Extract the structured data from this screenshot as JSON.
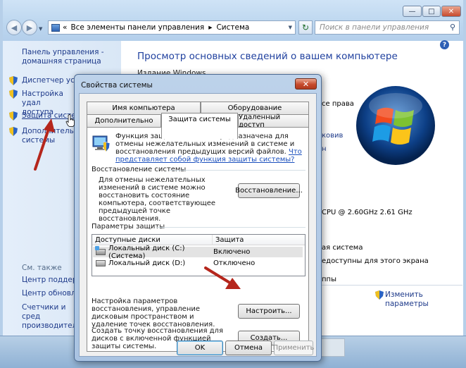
{
  "window": {
    "minimize_glyph": "—",
    "maximize_glyph": "□",
    "close_glyph": "✕",
    "address_path": [
      "Все элементы панели управления",
      "Система"
    ],
    "address_prefix": "«",
    "search_placeholder": "Поиск в панели управления"
  },
  "sidebar": {
    "home_link": "Панель управления - домашняя страница",
    "items": [
      {
        "label": "Диспетчер устр"
      },
      {
        "label": "Настройка удал доступа"
      },
      {
        "label": "Защита систем"
      },
      {
        "label": "Дополнительн системы"
      }
    ],
    "see_also": "См. также",
    "see_also_items": [
      "Центр поддерж",
      "Центр обновле",
      "Счетчики и сред производительн"
    ]
  },
  "main": {
    "heading": "Просмотр основных сведений о вашем компьютере",
    "partial_top": "Издание Windows",
    "partial_rights": "се права",
    "partial_link": "ковив",
    "partial_link2": "н",
    "partial_cpu": "CPU @ 2.60GHz   2.61 GHz",
    "partial_system": "ая система",
    "partial_pen": "едоступны для этого экрана",
    "partial_groups": "ппы",
    "change_params": "Изменить параметры"
  },
  "dialog": {
    "title": "Свойства системы",
    "close_glyph": "✕",
    "tabs_top": [
      "Имя компьютера",
      "Оборудование"
    ],
    "tabs_bottom": [
      "Дополнительно",
      "Защита системы",
      "Удаленный доступ"
    ],
    "active_tab": "Защита системы",
    "intro_text": "Функция защиты системы предназначена для отмены нежелательных изменений в системе и восстановления предыдущих версий файлов.",
    "intro_link": "Что представляет собой функция защиты системы?",
    "restore_group": "Восстановление системы",
    "restore_text": "Для отмены нежелательных изменений в системе можно восстановить состояние компьютера, соответствующее предыдущей точке восстановления.",
    "restore_button": "Восстановление...",
    "protect_group": "Параметры защиты",
    "columns": [
      "Доступные диски",
      "Защита"
    ],
    "disks": [
      {
        "name": "Локальный диск (C:) (Система)",
        "status": "Включено"
      },
      {
        "name": "Локальный диск (D:)",
        "status": "Отключено"
      }
    ],
    "configure_text": "Настройка параметров восстановления, управление дисковым пространством и удаление точек восстановления.",
    "configure_button": "Настроить...",
    "create_text": "Создать точку восстановления для дисков с включенной функцией защиты системы.",
    "create_button": "Создать...",
    "ok_button": "OK",
    "cancel_button": "Отмена",
    "apply_button": "Применить"
  },
  "colors": {
    "link": "#1e3a8a",
    "heading": "#1e3f9e",
    "annotation_arrow": "#b5261c"
  }
}
